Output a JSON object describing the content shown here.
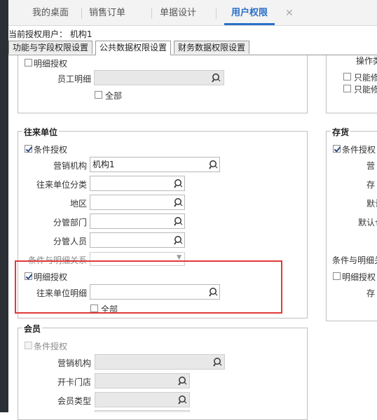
{
  "tabs": [
    {
      "label": "我的桌面"
    },
    {
      "label": "销售订单"
    },
    {
      "label": "单据设计"
    },
    {
      "label": "用户权限"
    }
  ],
  "current_user": "当前授权用户： 机构1",
  "subtabs": [
    {
      "label": "功能与字段权限设置"
    },
    {
      "label": "公共数据权限设置"
    },
    {
      "label": "财务数据权限设置"
    }
  ],
  "top_group": {
    "detail_auth": "明细授权",
    "employee_detail_label": "员工明细",
    "all_label": "全部"
  },
  "right_top": {
    "operation_label": "操作类",
    "only_mod_1": "只能修",
    "only_mod_2": "只能修"
  },
  "wanglai": {
    "title": "往来单位",
    "cond_auth": "条件授权",
    "org_label": "营销机构",
    "org_value": "机构1",
    "category_label": "往来单位分类",
    "region_label": "地区",
    "dept_label": "分管部门",
    "staff_label": "分管人员",
    "relation_label": "条件与明细关系",
    "detail_auth": "明细授权",
    "detail_label": "往来单位明细",
    "all_label": "全部"
  },
  "cunhuo": {
    "title": "存货",
    "cond_auth": "条件授权",
    "l1": "营",
    "l2": "存",
    "l3": "默认",
    "l4": "默认仓",
    "relation": "条件与明细关",
    "detail_auth": "明细授权",
    "l5": "存"
  },
  "huiyuan": {
    "title": "会员",
    "cond_auth": "条件授权",
    "org_label": "营销机构",
    "store_label": "开卡门店",
    "type_label": "会员类型"
  }
}
